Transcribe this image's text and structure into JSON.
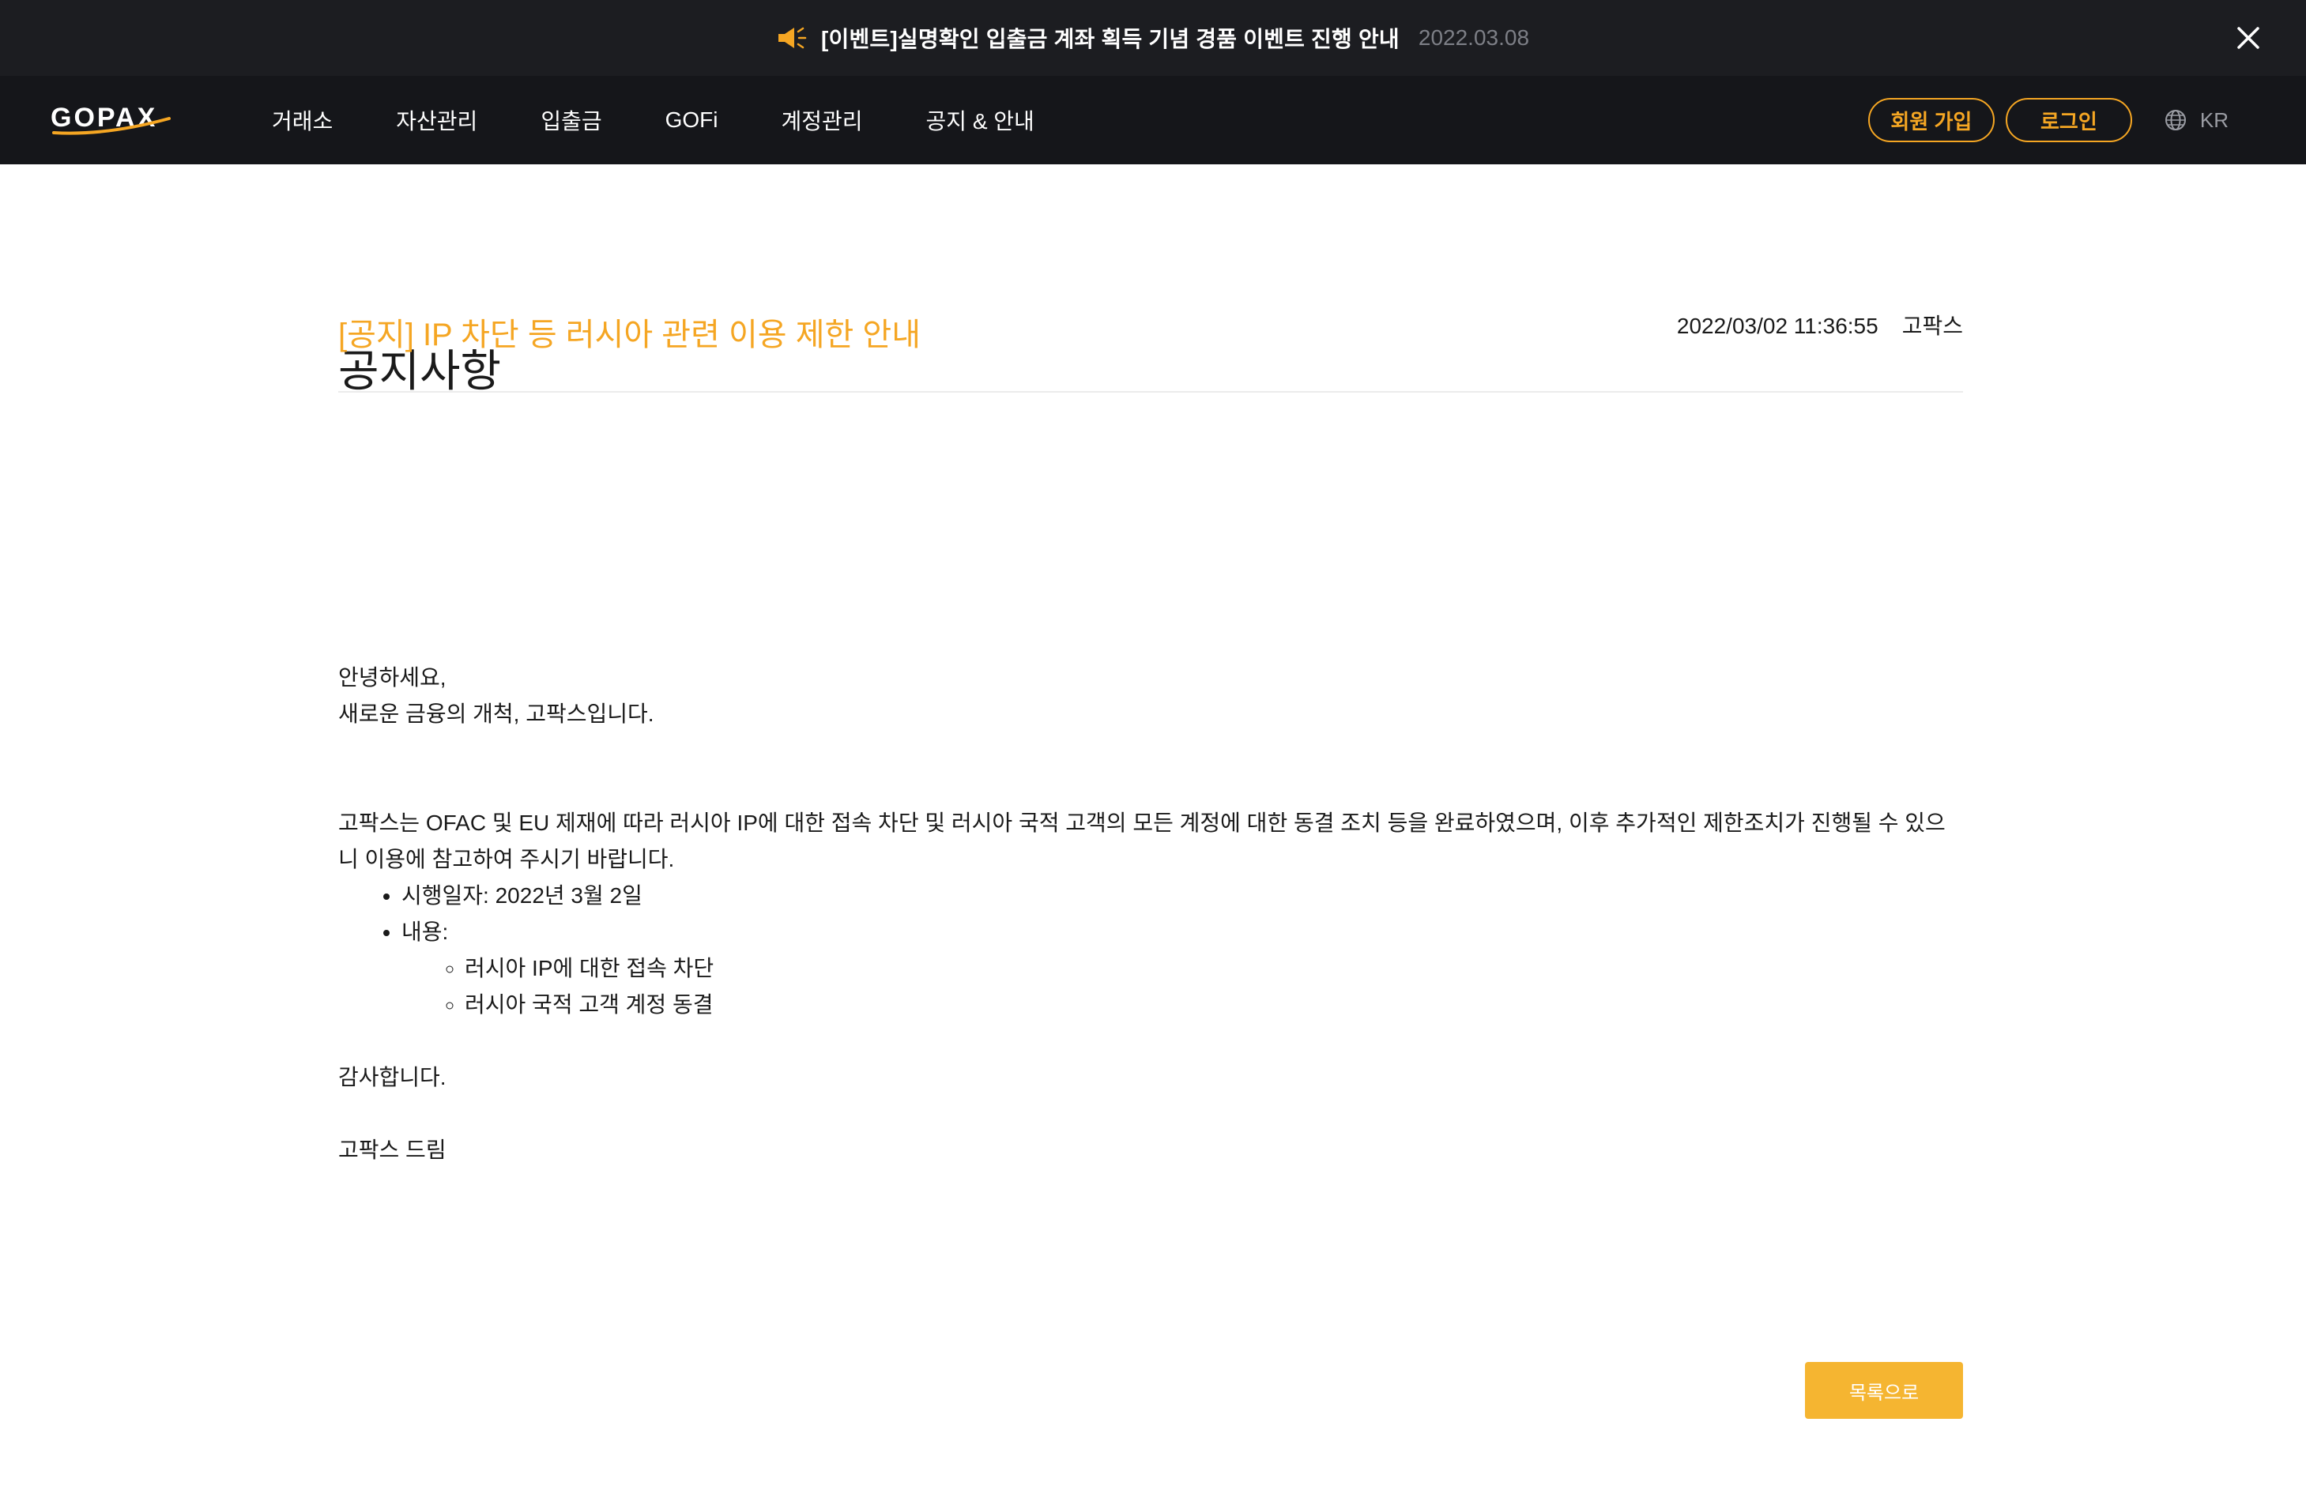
{
  "banner": {
    "icon": "megaphone-icon",
    "text": "[이벤트]실명확인 입출금 계좌 획득 기념 경품 이벤트 진행 안내",
    "date": "2022.03.08",
    "close_icon": "close-icon"
  },
  "nav": {
    "logo": "GOPAX",
    "items": [
      "거래소",
      "자산관리",
      "입출금",
      "GOFi",
      "계정관리",
      "공지 & 안내"
    ],
    "signup_label": "회원 가입",
    "login_label": "로그인",
    "lang_icon": "globe-icon",
    "lang_label": "KR"
  },
  "page": {
    "title": "공지사항"
  },
  "post": {
    "title": "[공지] IP 차단 등 러시아 관련 이용 제한 안내",
    "datetime": "2022/03/02 11:36:55",
    "author": "고팍스",
    "greeting_1": "안녕하세요,",
    "greeting_2": "새로운 금융의 개척, 고팍스입니다.",
    "paragraph": "고팍스는 OFAC 및 EU 제재에 따라 러시아 IP에 대한 접속 차단 및 러시아 국적 고객의 모든 계정에 대한 동결 조치 등을 완료하였으며, 이후 추가적인 제한조치가 진행될 수 있으니 이용에 참고하여 주시기 바랍니다.",
    "bullet_date": "시행일자: 2022년 3월 2일",
    "bullet_content": "내용:",
    "sub_1": "러시아 IP에 대한 접속 차단",
    "sub_2": "러시아 국적 고객 계정 동결",
    "thanks": "감사합니다.",
    "signoff": "고팍스 드림"
  },
  "actions": {
    "list_button": "목록으로"
  },
  "colors": {
    "accent": "#f5a623",
    "banner_bg": "#1c1d21",
    "nav_bg": "#15161a"
  }
}
